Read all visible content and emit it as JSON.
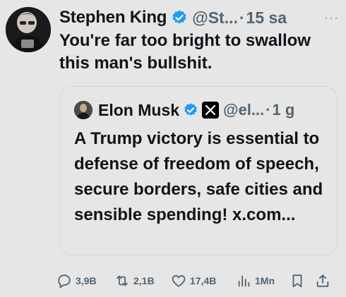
{
  "tweet": {
    "author_name": "Stephen King",
    "author_handle": "@St...",
    "separator": "·",
    "time": "15 sa",
    "more": "···",
    "text": "You're far too bright to swallow this man's bullshit."
  },
  "quote": {
    "author_name": "Elon Musk",
    "author_handle": "@el...",
    "separator": "·",
    "time": "1 g",
    "text": "A Trump victory is essential to defense of freedom of speech, secure borders, safe cities and sensible spending! x.com..."
  },
  "actions": {
    "replies": "3,9B",
    "reposts": "2,1B",
    "likes": "17,4B",
    "views": "1Mn"
  },
  "colors": {
    "background": "#e6e6e6",
    "text": "#0f1419",
    "muted": "#536471",
    "verified": "#1d9bf0"
  },
  "icons": [
    "verified-badge-icon",
    "x-logo-icon",
    "reply-icon",
    "repost-icon",
    "like-icon",
    "views-icon",
    "bookmark-icon",
    "share-icon"
  ]
}
